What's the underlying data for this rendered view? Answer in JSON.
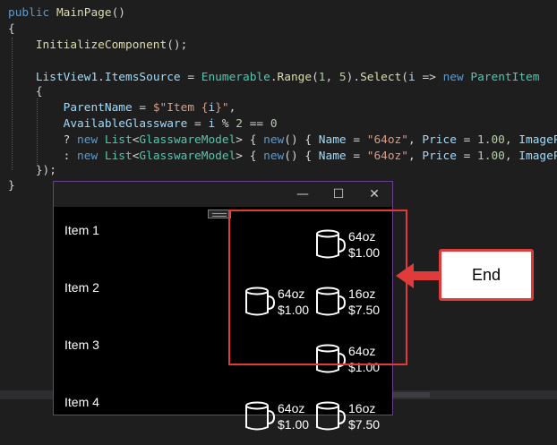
{
  "code": {
    "lines": [
      [
        {
          "t": "public ",
          "c": "kw"
        },
        {
          "t": "MainPage",
          "c": "fn"
        },
        {
          "t": "()",
          "c": "pl"
        }
      ],
      [
        {
          "t": "{",
          "c": "pl"
        }
      ],
      [
        {
          "t": "    ",
          "c": "pl"
        },
        {
          "t": "InitializeComponent",
          "c": "fn"
        },
        {
          "t": "();",
          "c": "pl"
        }
      ],
      [
        {
          "t": "",
          "c": "pl"
        }
      ],
      [
        {
          "t": "    ",
          "c": "pl"
        },
        {
          "t": "ListView1",
          "c": "id"
        },
        {
          "t": ".",
          "c": "pl"
        },
        {
          "t": "ItemsSource",
          "c": "id"
        },
        {
          "t": " = ",
          "c": "pl"
        },
        {
          "t": "Enumerable",
          "c": "ty"
        },
        {
          "t": ".",
          "c": "pl"
        },
        {
          "t": "Range",
          "c": "fn"
        },
        {
          "t": "(",
          "c": "pl"
        },
        {
          "t": "1",
          "c": "nu"
        },
        {
          "t": ", ",
          "c": "pl"
        },
        {
          "t": "5",
          "c": "nu"
        },
        {
          "t": ").",
          "c": "pl"
        },
        {
          "t": "Select",
          "c": "fn"
        },
        {
          "t": "(",
          "c": "pl"
        },
        {
          "t": "i",
          "c": "id"
        },
        {
          "t": " => ",
          "c": "pl"
        },
        {
          "t": "new ",
          "c": "kw"
        },
        {
          "t": "ParentItem",
          "c": "ty"
        }
      ],
      [
        {
          "t": "    {",
          "c": "pl"
        }
      ],
      [
        {
          "t": "        ",
          "c": "pl"
        },
        {
          "t": "ParentName",
          "c": "id"
        },
        {
          "t": " = ",
          "c": "pl"
        },
        {
          "t": "$\"Item {",
          "c": "st"
        },
        {
          "t": "i",
          "c": "id"
        },
        {
          "t": "}\"",
          "c": "st"
        },
        {
          "t": ",",
          "c": "pl"
        }
      ],
      [
        {
          "t": "        ",
          "c": "pl"
        },
        {
          "t": "AvailableGlassware",
          "c": "id"
        },
        {
          "t": " = ",
          "c": "pl"
        },
        {
          "t": "i",
          "c": "id"
        },
        {
          "t": " % ",
          "c": "pl"
        },
        {
          "t": "2",
          "c": "nu"
        },
        {
          "t": " == ",
          "c": "pl"
        },
        {
          "t": "0",
          "c": "nu"
        }
      ],
      [
        {
          "t": "        ? ",
          "c": "pl"
        },
        {
          "t": "new ",
          "c": "kw"
        },
        {
          "t": "List",
          "c": "ty"
        },
        {
          "t": "<",
          "c": "pl"
        },
        {
          "t": "GlasswareModel",
          "c": "ty"
        },
        {
          "t": "> { ",
          "c": "pl"
        },
        {
          "t": "new",
          "c": "kw"
        },
        {
          "t": "() { ",
          "c": "pl"
        },
        {
          "t": "Name",
          "c": "id"
        },
        {
          "t": " = ",
          "c": "pl"
        },
        {
          "t": "\"64oz\"",
          "c": "st"
        },
        {
          "t": ", ",
          "c": "pl"
        },
        {
          "t": "Price",
          "c": "id"
        },
        {
          "t": " = ",
          "c": "pl"
        },
        {
          "t": "1.00",
          "c": "nu"
        },
        {
          "t": ", ",
          "c": "pl"
        },
        {
          "t": "ImagePa",
          "c": "id"
        }
      ],
      [
        {
          "t": "        : ",
          "c": "pl"
        },
        {
          "t": "new ",
          "c": "kw"
        },
        {
          "t": "List",
          "c": "ty"
        },
        {
          "t": "<",
          "c": "pl"
        },
        {
          "t": "GlasswareModel",
          "c": "ty"
        },
        {
          "t": "> { ",
          "c": "pl"
        },
        {
          "t": "new",
          "c": "kw"
        },
        {
          "t": "() { ",
          "c": "pl"
        },
        {
          "t": "Name",
          "c": "id"
        },
        {
          "t": " = ",
          "c": "pl"
        },
        {
          "t": "\"64oz\"",
          "c": "st"
        },
        {
          "t": ", ",
          "c": "pl"
        },
        {
          "t": "Price",
          "c": "id"
        },
        {
          "t": " = ",
          "c": "pl"
        },
        {
          "t": "1.00",
          "c": "nu"
        },
        {
          "t": ", ",
          "c": "pl"
        },
        {
          "t": "ImagePa",
          "c": "id"
        }
      ],
      [
        {
          "t": "    });",
          "c": "pl"
        }
      ],
      [
        {
          "t": "}",
          "c": "pl"
        }
      ]
    ]
  },
  "window": {
    "minimize_icon": "—",
    "maximize_icon": "☐",
    "close_icon": "✕"
  },
  "items": [
    {
      "label": "Item 1",
      "glassware": [
        {
          "name": "64oz",
          "price": "$1.00"
        }
      ]
    },
    {
      "label": "Item 2",
      "glassware": [
        {
          "name": "64oz",
          "price": "$1.00"
        },
        {
          "name": "16oz",
          "price": "$7.50"
        }
      ]
    },
    {
      "label": "Item 3",
      "glassware": [
        {
          "name": "64oz",
          "price": "$1.00"
        }
      ]
    },
    {
      "label": "Item 4",
      "glassware": [
        {
          "name": "64oz",
          "price": "$1.00"
        },
        {
          "name": "16oz",
          "price": "$7.50"
        }
      ]
    }
  ],
  "callout": {
    "label": "End"
  },
  "colors": {
    "highlight": "#e03b3b",
    "window_border": "#6b3f8f"
  }
}
